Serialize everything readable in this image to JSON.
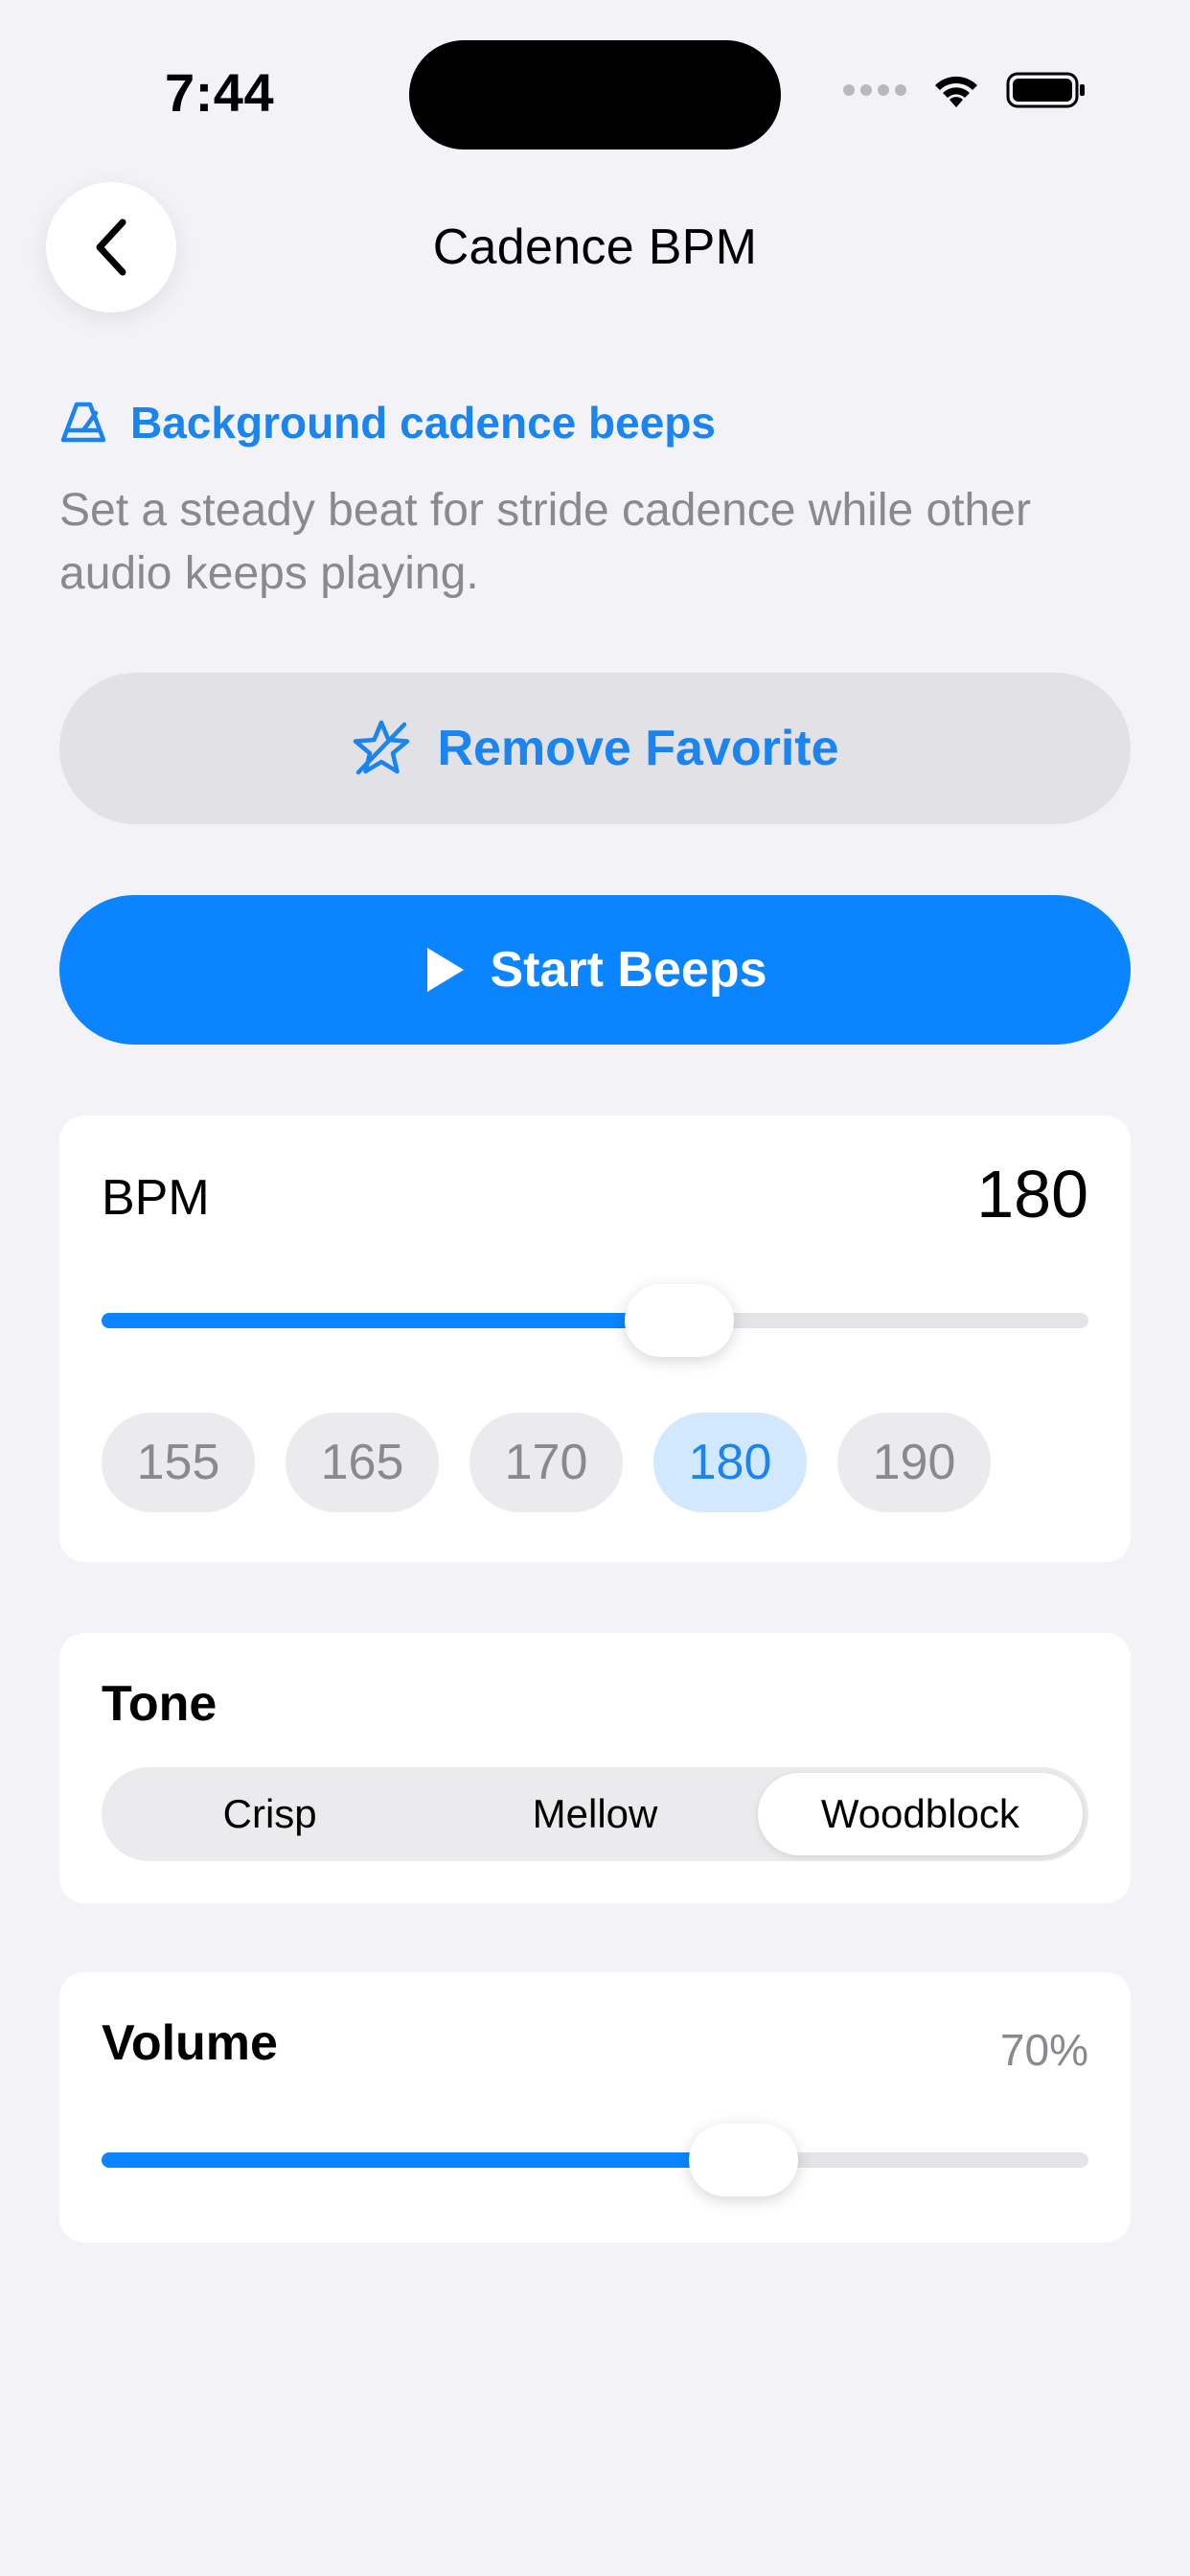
{
  "status_bar": {
    "time": "7:44"
  },
  "nav": {
    "title": "Cadence BPM",
    "back_icon": "chevron-left-icon"
  },
  "header": {
    "icon": "metronome-icon",
    "subtitle": "Background cadence beeps",
    "description": "Set a steady beat for stride cadence while other audio keeps playing."
  },
  "favorite_button": {
    "icon": "star-slash-icon",
    "label": "Remove Favorite"
  },
  "start_button": {
    "icon": "play-icon",
    "label": "Start Beeps"
  },
  "bpm": {
    "label": "BPM",
    "value": "180",
    "slider_fraction": 0.585,
    "presets": [
      {
        "label": "155",
        "active": false
      },
      {
        "label": "165",
        "active": false
      },
      {
        "label": "170",
        "active": false
      },
      {
        "label": "180",
        "active": true
      },
      {
        "label": "190",
        "active": false
      }
    ]
  },
  "tone": {
    "label": "Tone",
    "options": [
      "Crisp",
      "Mellow",
      "Woodblock"
    ],
    "selected": "Woodblock"
  },
  "volume": {
    "label": "Volume",
    "value": "70%",
    "slider_fraction": 0.65
  },
  "colors": {
    "accent": "#0a84ff",
    "accent_text": "#1a84f0",
    "background": "#f2f2f7",
    "secondary_text": "#8a8a8e"
  }
}
